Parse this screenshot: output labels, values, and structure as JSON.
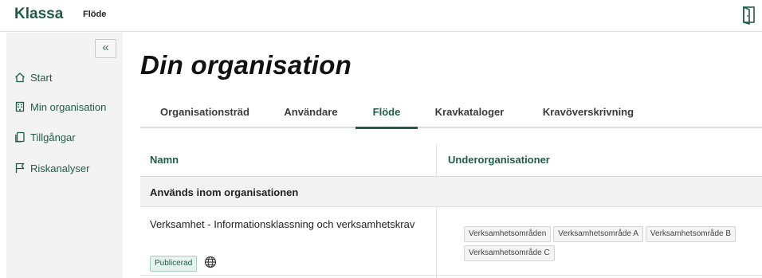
{
  "app": {
    "brand": "Klassa",
    "section": "Flöde"
  },
  "icons": {
    "exit": "exit-door-icon",
    "collapse": "double-chevron-left-icon"
  },
  "sidebar": {
    "items": [
      {
        "label": "Start",
        "icon": "home-icon"
      },
      {
        "label": "Min organisation",
        "icon": "building-icon"
      },
      {
        "label": "Tillgångar",
        "icon": "copy-icon"
      },
      {
        "label": "Riskanalyser",
        "icon": "flag-icon"
      }
    ]
  },
  "main": {
    "title": "Din organisation",
    "tabs": [
      {
        "label": "Organisationsträd"
      },
      {
        "label": "Användare"
      },
      {
        "label": "Flöde",
        "active": true
      },
      {
        "label": "Kravkataloger"
      },
      {
        "label": "Kravöverskrivning"
      }
    ],
    "table": {
      "columns": [
        "Namn",
        "Underorganisationer"
      ],
      "group": "Används inom organisationen",
      "rows": [
        {
          "name": "Verksamhet - Informationsklassning och verksamhetskrav",
          "status": "Publicerad",
          "status_icon": "globe-icon",
          "suborgs": [
            "Verksamhetsområden",
            "Verksamhetsområde A",
            "Verksamhetsområde B",
            "Verksamhetsområde C"
          ]
        }
      ]
    }
  },
  "colors": {
    "brand": "#1f5c47",
    "sidebar_bg": "#f3f3f3",
    "status_bg": "#e6f2ed"
  }
}
